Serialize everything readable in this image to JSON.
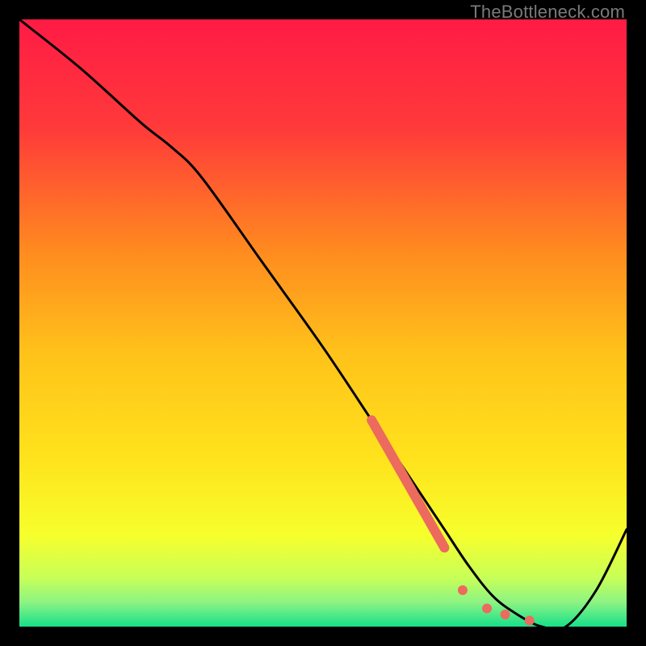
{
  "watermark": "TheBottleneck.com",
  "chart_data": {
    "type": "line",
    "title": "",
    "xlabel": "",
    "ylabel": "",
    "xlim": [
      0,
      100
    ],
    "ylim": [
      0,
      100
    ],
    "grid": false,
    "legend": false,
    "background_gradient": {
      "top": "#ff1b45",
      "mid_upper": "#ff6a2a",
      "mid": "#ffd21c",
      "mid_lower": "#f6ff2c",
      "low": "#b6ff6e",
      "bottom": "#17e08a"
    },
    "series": [
      {
        "name": "bottleneck-curve",
        "x": [
          0,
          10,
          20,
          25,
          30,
          40,
          50,
          58,
          62,
          66,
          70,
          74,
          78,
          82,
          86,
          90,
          95,
          100
        ],
        "y": [
          100,
          92,
          83,
          79,
          74,
          60,
          46,
          34,
          28,
          22,
          16,
          10,
          5,
          2,
          0,
          0,
          6,
          16
        ],
        "stroke": "#000000",
        "stroke_width": 2
      }
    ],
    "markers": [
      {
        "name": "thick-segment",
        "type": "line-segment",
        "x": [
          58,
          70
        ],
        "y": [
          34,
          13
        ],
        "stroke": "#ec6a5e",
        "stroke_width": 12,
        "cap": "round"
      },
      {
        "name": "dot-1",
        "type": "point",
        "x": 73,
        "y": 6,
        "fill": "#ec6a5e",
        "r": 6
      },
      {
        "name": "dot-2",
        "type": "point",
        "x": 77,
        "y": 3,
        "fill": "#ec6a5e",
        "r": 6
      },
      {
        "name": "dot-3",
        "type": "point",
        "x": 80,
        "y": 2,
        "fill": "#ec6a5e",
        "r": 6
      },
      {
        "name": "dot-4",
        "type": "point",
        "x": 84,
        "y": 1,
        "fill": "#ec6a5e",
        "r": 6
      }
    ]
  }
}
